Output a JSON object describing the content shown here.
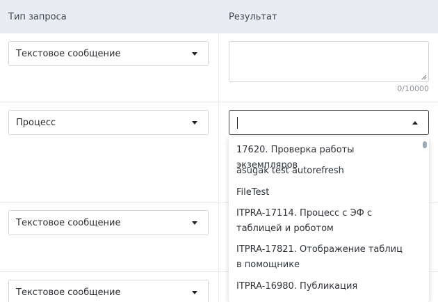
{
  "table": {
    "headers": {
      "type": "Тип запроса",
      "result": "Результат"
    }
  },
  "rows": [
    {
      "type_value": "Текстовое сообщение"
    },
    {
      "type_value": "Процесс"
    },
    {
      "type_value": "Текстовое сообщение"
    },
    {
      "type_value": "Текстовое сообщение"
    }
  ],
  "result_textarea": {
    "value": "",
    "counter": "0/10000"
  },
  "process_combobox": {
    "value": "",
    "options": [
      "17620. Проверка работы экземпляров",
      "asugak test autorefresh",
      "FileTest",
      "ITPRA-17114. Процесс с ЭФ с таблицей и роботом",
      "ITPRA-17821. Отображение таблиц в помощнике",
      "ITPRA-16980. Публикация"
    ]
  },
  "colors": {
    "header_bg": "#e9edf3",
    "border": "#cfd5dd",
    "focus_border": "#3a3f45",
    "scroll_thumb": "#9ea9bd"
  },
  "icons": [
    "caret-down-icon",
    "caret-up-icon",
    "resize-grip-icon"
  ]
}
